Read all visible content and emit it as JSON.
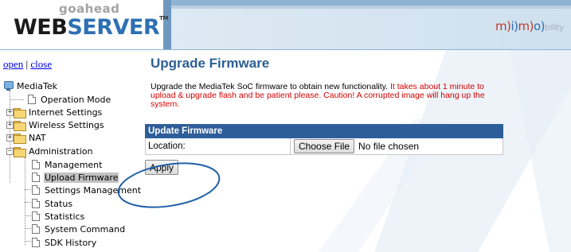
{
  "header": {
    "logo_top": "goahead",
    "logo_web": "WEB",
    "logo_server": "SERVER",
    "logo_tm": "TM",
    "brand_m1": "m)",
    "brand_i": "i)",
    "brand_m2": "m)",
    "brand_o": "o)",
    "brand_bility": "bility"
  },
  "nav": {
    "open_label": "open",
    "separator": " | ",
    "close_label": "close"
  },
  "tree": {
    "root": "MediaTek",
    "items": [
      {
        "label": "Operation Mode",
        "type": "page"
      },
      {
        "label": "Internet Settings",
        "type": "folder",
        "expander": "+"
      },
      {
        "label": "Wireless Settings",
        "type": "folder",
        "expander": "+"
      },
      {
        "label": "NAT",
        "type": "folder",
        "expander": "+"
      },
      {
        "label": "Administration",
        "type": "folder",
        "expander": "−"
      },
      {
        "label": "Management",
        "type": "page"
      },
      {
        "label": "Upload Firmware",
        "type": "page",
        "selected": true
      },
      {
        "label": "Settings Management",
        "type": "page"
      },
      {
        "label": "Status",
        "type": "page"
      },
      {
        "label": "Statistics",
        "type": "page"
      },
      {
        "label": "System Command",
        "type": "page"
      },
      {
        "label": "SDK History",
        "type": "page"
      }
    ]
  },
  "main": {
    "title": "Upgrade Firmware",
    "desc_normal": "Upgrade the MediaTek SoC firmware to obtain new functionality.",
    "desc_warn": " It takes about 1 minute to upload & upgrade flash and be patient please. Caution! A corrupted image will hang up the system.",
    "table_header": "Update Firmware",
    "location_label": "Location:",
    "choose_file_label": "Choose File",
    "no_file_text": "No file chosen",
    "apply_label": "Apply"
  },
  "colors": {
    "title_blue": "#2c5f93",
    "table_header_bg": "#2e5e9a",
    "warning_red": "#d40000",
    "annotation_ellipse": "#1f5fa8",
    "link_blue": "#0000ee"
  }
}
